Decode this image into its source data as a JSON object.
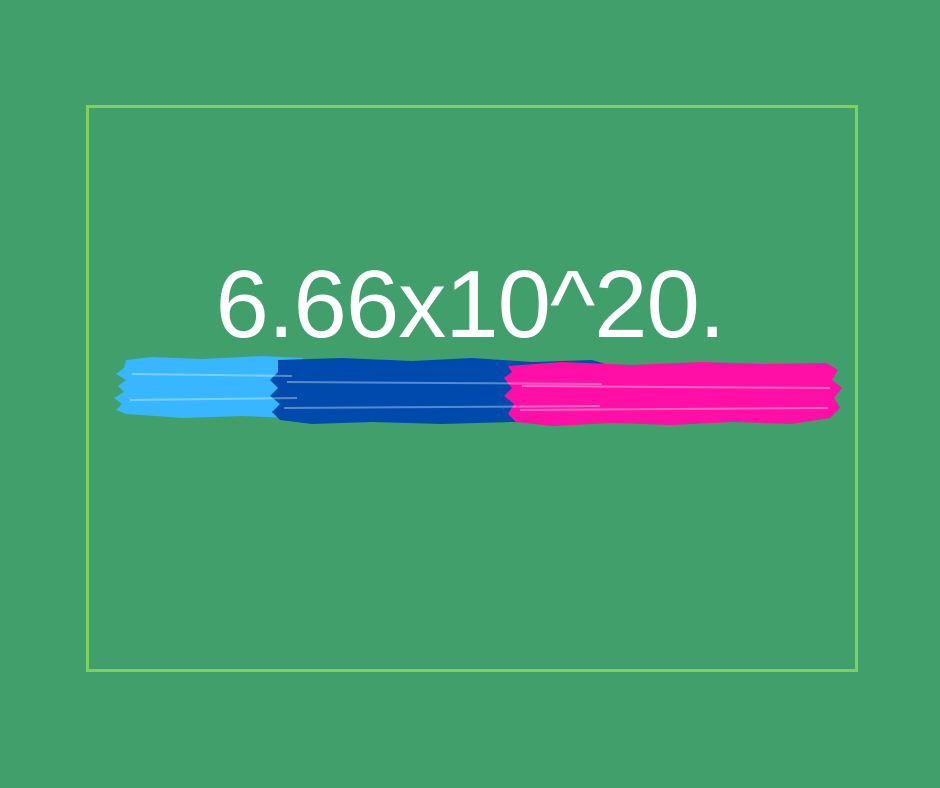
{
  "background_color": "#419f6c",
  "frame_color": "#7fd15f",
  "headline": {
    "text": "6.66x10^20.",
    "color": "#ffffff"
  },
  "paint_strokes": [
    {
      "name": "light-blue-stroke",
      "color": "#38b6ff"
    },
    {
      "name": "dark-blue-stroke",
      "color": "#004aad"
    },
    {
      "name": "pink-stroke",
      "color": "#ff0fa5"
    }
  ]
}
